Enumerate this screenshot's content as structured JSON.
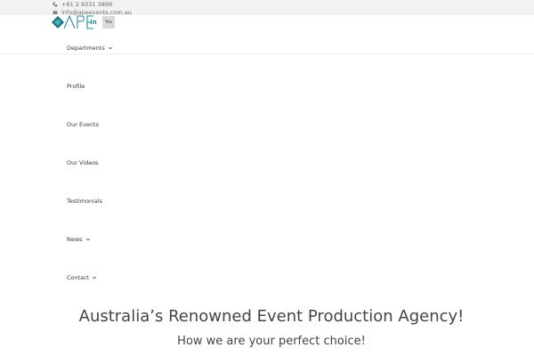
{
  "topbar": {
    "phone": "+61 2 9331 3899",
    "email": "info@apeevents.com.au"
  },
  "social": {
    "linkedin_label": "in",
    "youtube_label": "You"
  },
  "nav": {
    "items": [
      {
        "label": "Departments",
        "has_dropdown": true
      },
      {
        "label": "Profile",
        "has_dropdown": false
      },
      {
        "label": "Our Events",
        "has_dropdown": false
      },
      {
        "label": "Our Videos",
        "has_dropdown": false
      },
      {
        "label": "Testimonials",
        "has_dropdown": false
      },
      {
        "label": "News",
        "has_dropdown": true
      },
      {
        "label": "Contact",
        "has_dropdown": true
      }
    ]
  },
  "hero": {
    "title": "Australia’s Renowned Event Production Agency!",
    "subtitle": "How we are your perfect choice!"
  },
  "colors": {
    "brand_teal": "#2a8a93",
    "topbar_bg": "#f2f2f2",
    "text": "#444444"
  }
}
